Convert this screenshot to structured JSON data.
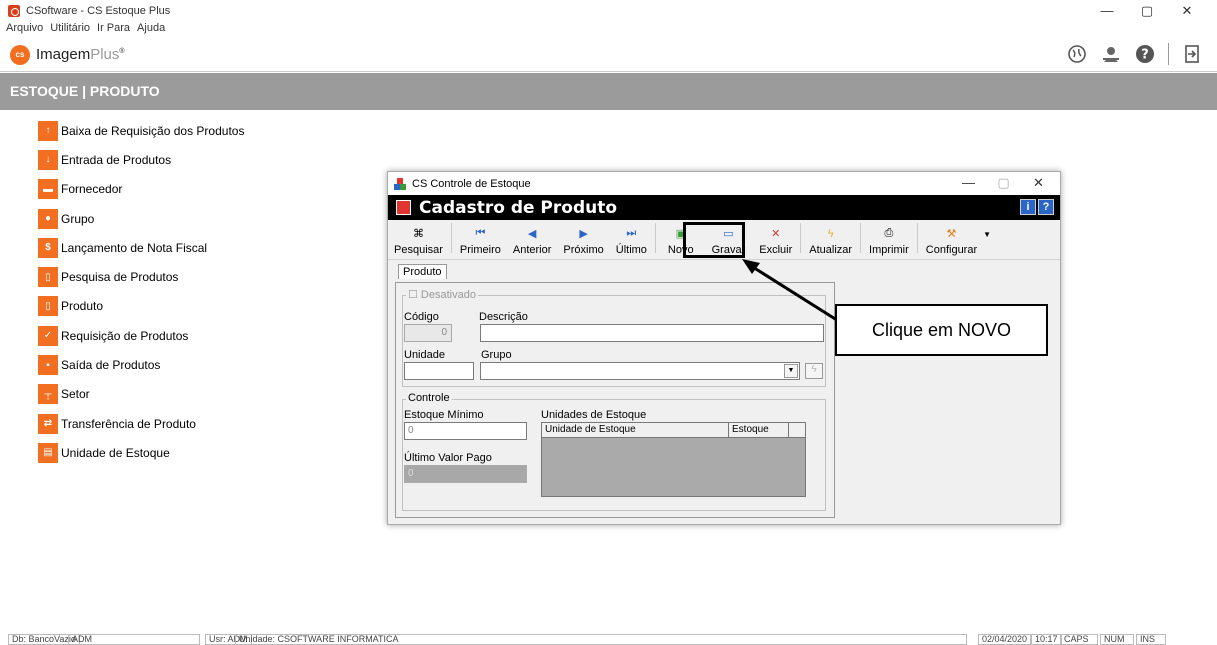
{
  "window": {
    "title": "CSoftware - CS Estoque Plus",
    "controls": [
      "—",
      "▢",
      "✕"
    ]
  },
  "menu": [
    "Arquivo",
    "Utilitário",
    "Ir Para",
    "Ajuda"
  ],
  "header": {
    "logo_badge": "cs",
    "logo_text": "Imagem",
    "logo_plus": "Plus",
    "icons": [
      "globe-icon",
      "user-icon",
      "help-icon",
      "exit-icon"
    ]
  },
  "section_title": "ESTOQUE | PRODUTO",
  "sidebar": {
    "items": [
      {
        "label": "Baixa de Requisição dos Produtos",
        "icon": "requisition-down-icon"
      },
      {
        "label": "Entrada de Produtos",
        "icon": "entry-icon"
      },
      {
        "label": "Fornecedor",
        "icon": "truck-icon"
      },
      {
        "label": "Grupo",
        "icon": "group-icon"
      },
      {
        "label": "Lançamento de Nota Fiscal",
        "icon": "invoice-icon"
      },
      {
        "label": "Pesquisa de Produtos",
        "icon": "database-icon"
      },
      {
        "label": "Produto",
        "icon": "database-icon"
      },
      {
        "label": "Requisição de Produtos",
        "icon": "check-icon"
      },
      {
        "label": "Saída de Produtos",
        "icon": "exit-products-icon"
      },
      {
        "label": "Setor",
        "icon": "org-chart-icon"
      },
      {
        "label": "Transferência de Produto",
        "icon": "transfer-icon"
      },
      {
        "label": "Unidade de Estoque",
        "icon": "stock-unit-icon"
      }
    ]
  },
  "dialog": {
    "title": "CS Controle de Estoque",
    "header_title": "Cadastro de Produto",
    "header_buttons": [
      "i",
      "?"
    ],
    "toolbar": [
      {
        "label": "Pesquisar",
        "icon": "binoculars-icon"
      },
      {
        "label": "Primeiro",
        "icon": "first-icon"
      },
      {
        "label": "Anterior",
        "icon": "previous-icon"
      },
      {
        "label": "Próximo",
        "icon": "next-icon"
      },
      {
        "label": "Último",
        "icon": "last-icon"
      },
      {
        "label": "Novo",
        "icon": "new-icon"
      },
      {
        "label": "Gravar",
        "icon": "save-icon"
      },
      {
        "label": "Excluir",
        "icon": "delete-icon"
      },
      {
        "label": "Atualizar",
        "icon": "refresh-icon"
      },
      {
        "label": "Imprimir",
        "icon": "print-icon"
      },
      {
        "label": "Configurar",
        "icon": "config-icon"
      }
    ],
    "tab": "Produto",
    "desativado": "Desativado",
    "codigo_label": "Código",
    "codigo_value": "0",
    "descricao_label": "Descrição",
    "unidade_label": "Unidade",
    "grupo_label": "Grupo",
    "controle_label": "Controle",
    "estoque_minimo_label": "Estoque Mínimo",
    "estoque_minimo_value": "0",
    "ultimo_valor_label": "Último Valor Pago",
    "ultimo_valor_value": "0",
    "unidades_estoque_label": "Unidades de Estoque",
    "grid_columns": [
      "Unidade de Estoque",
      "Estoque"
    ]
  },
  "callout": "Clique em NOVO",
  "status": {
    "db": "Db: BancoVazio",
    "user_short": "ADM",
    "usr": "Usr: ADM",
    "unidade": "Unidade: CSOFTWARE INFORMATICA",
    "date": "02/04/2020",
    "time": "10:17",
    "caps": "CAPS",
    "num": "NUM",
    "ins": "INS"
  },
  "colors": {
    "brand_orange": "#f26f21",
    "section_gray": "#9b9b9b",
    "dialog_header": "#000000"
  }
}
